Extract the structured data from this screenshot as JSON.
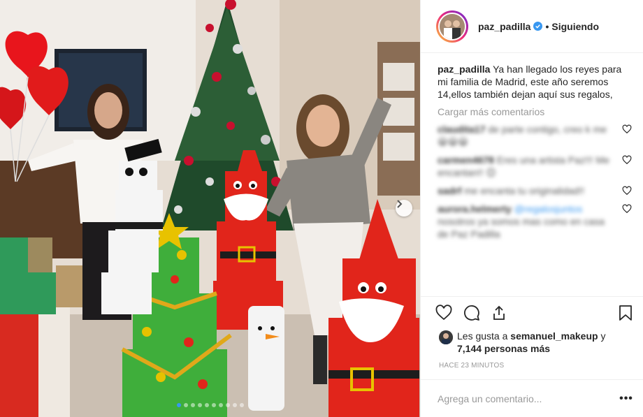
{
  "post": {
    "username": "paz_padilla",
    "verified": true,
    "follow_status": "Siguiendo",
    "separator": "•",
    "caption": "Ya han llegado los reyes para mi familia de Madrid, este año seremos 14,ellos también dejan aquí sus regalos,",
    "load_more_label": "Cargar más comentarios",
    "comments": [
      {
        "user": "claudita17",
        "text": "de parte contigo, creo k me 😀😀😀"
      },
      {
        "user": "carmen4678",
        "text": "Eres una artista Paz!!! Me encantan!! 😊"
      },
      {
        "user": "sadrf",
        "text": "me encanta tu originalidad!!"
      },
      {
        "user": "aurora.helmerty",
        "text": "nosotros ya somos mas como en casa de Paz Padilla",
        "link": "@regalosjuntos"
      }
    ],
    "likes_prefix": "Les gusta a",
    "likes_user": "semanuel_makeup",
    "likes_joiner": "y",
    "likes_count": "7,144 personas más",
    "timestamp": "HACE 23 MINUTOS",
    "comment_placeholder": "Agrega un comentario...",
    "more_options": "•••"
  },
  "carousel": {
    "slides": 10,
    "active_index": 0
  },
  "icons": {
    "like": "heart-icon",
    "comment": "comment-bubble-icon",
    "share": "share-icon",
    "save": "bookmark-icon",
    "next": "chevron-right-icon",
    "verified": "verified-badge-icon"
  },
  "colors": {
    "accent": "#3897f0",
    "muted": "#999999",
    "text": "#262626",
    "border": "#efefef"
  }
}
